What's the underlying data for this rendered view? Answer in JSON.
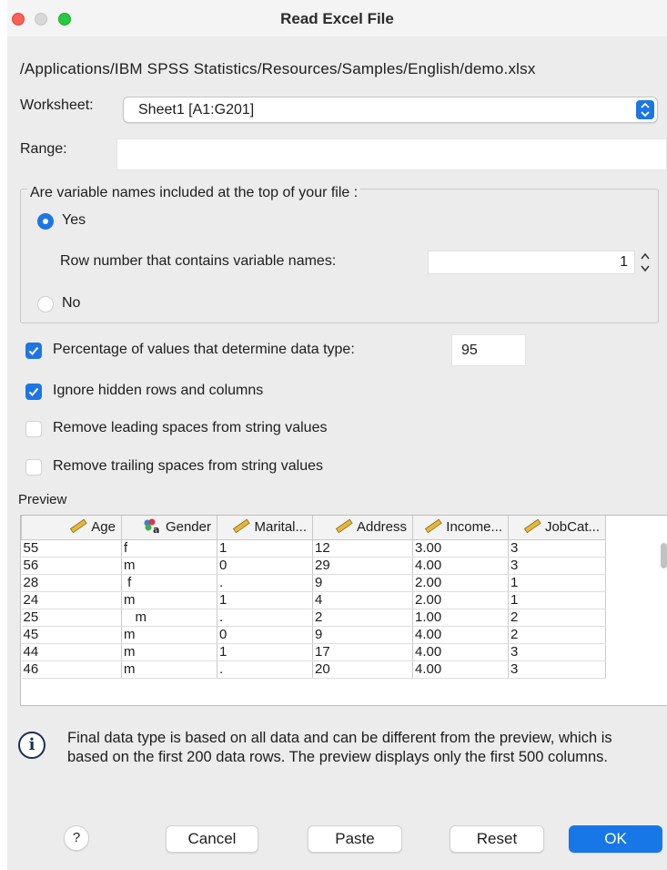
{
  "window": {
    "title": "Read Excel File"
  },
  "file_path": "/Applications/IBM SPSS Statistics/Resources/Samples/English/demo.xlsx",
  "worksheet": {
    "label": "Worksheet:",
    "value": "Sheet1 [A1:G201]"
  },
  "range": {
    "label": "Range:",
    "value": ""
  },
  "variable_names": {
    "title": "Are variable names included at the top of your file :",
    "yes_label": "Yes",
    "no_label": "No",
    "selected": "Yes",
    "row_number_label": "Row number that contains variable names:",
    "row_number_value": "1"
  },
  "options": {
    "percentage": {
      "label": "Percentage of values that determine data type:",
      "checked": true,
      "value": "95"
    },
    "ignore_hidden": {
      "label": "Ignore hidden rows and columns",
      "checked": true
    },
    "remove_leading": {
      "label": "Remove leading spaces from string values",
      "checked": false
    },
    "remove_trailing": {
      "label": "Remove trailing spaces from string values",
      "checked": false
    }
  },
  "preview": {
    "label": "Preview",
    "columns": [
      {
        "name": "Age",
        "icon": "ruler-scale-icon"
      },
      {
        "name": "Gender",
        "icon": "nominal-string-icon"
      },
      {
        "name": "Marital...",
        "icon": "ruler-scale-icon"
      },
      {
        "name": "Address",
        "icon": "ruler-scale-icon"
      },
      {
        "name": "Income...",
        "icon": "ruler-scale-icon"
      },
      {
        "name": "JobCat...",
        "icon": "ruler-scale-icon"
      }
    ],
    "rows": [
      [
        "55",
        "f",
        "1",
        "12",
        "3.00",
        "3"
      ],
      [
        "56",
        "m",
        "0",
        "29",
        "4.00",
        "3"
      ],
      [
        "28",
        " f",
        ".",
        "9",
        "2.00",
        "1"
      ],
      [
        "24",
        "m",
        "1",
        "4",
        "2.00",
        "1"
      ],
      [
        "25",
        "   m",
        ".",
        "2",
        "1.00",
        "2"
      ],
      [
        "45",
        "m",
        "0",
        "9",
        "4.00",
        "2"
      ],
      [
        "44",
        "m",
        "1",
        "17",
        "4.00",
        "3"
      ],
      [
        "46",
        "m",
        ".",
        "20",
        "4.00",
        "3"
      ]
    ]
  },
  "info": {
    "icon": "info-icon",
    "text": "Final data type is based on all data and can be different from the preview, which is based on the first 200 data rows. The preview displays only the first 500 columns."
  },
  "buttons": {
    "help": "?",
    "cancel": "Cancel",
    "paste": "Paste",
    "reset": "Reset",
    "ok": "OK"
  },
  "colors": {
    "accent": "#1d76e3",
    "ok_button": "#1777e6",
    "close": "#fe5f57",
    "zoom": "#28c840"
  }
}
